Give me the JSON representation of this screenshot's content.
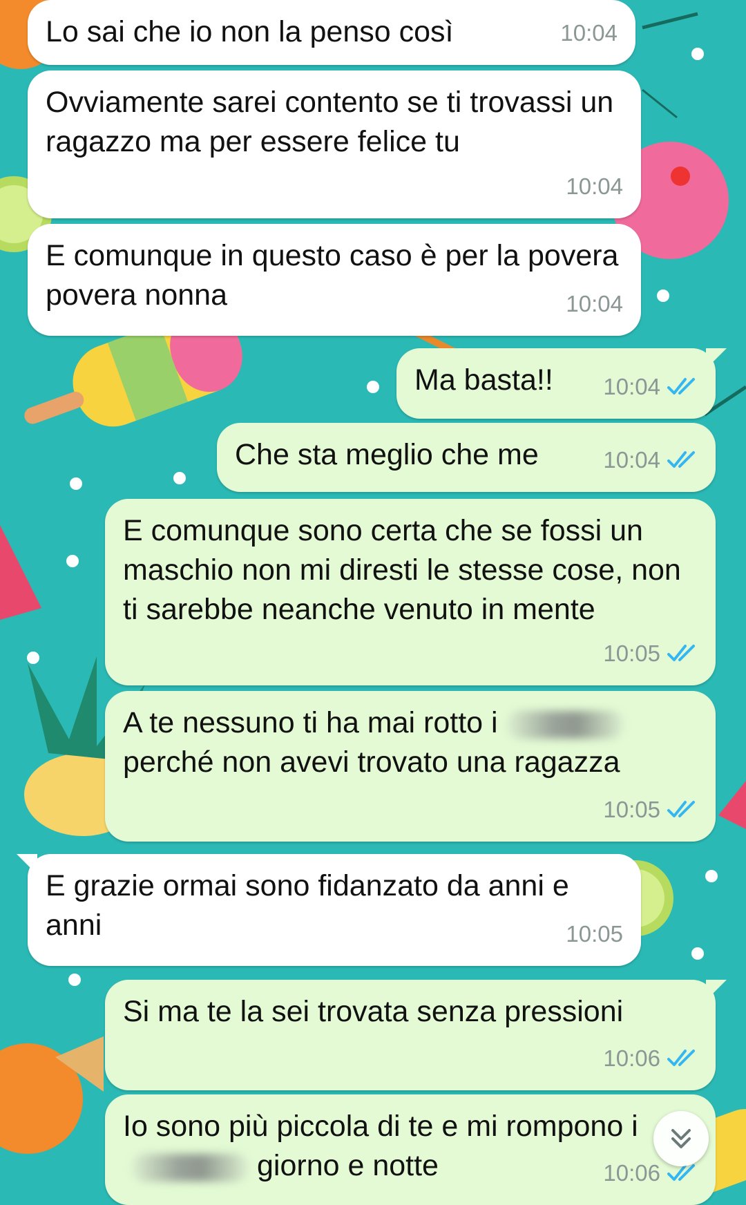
{
  "theme": {
    "wallpaper": "#2bb9b5",
    "incoming_bubble": "#ffffff",
    "outgoing_bubble": "#e3fad4",
    "read_tick": "#34b7f1"
  },
  "messages": [
    {
      "dir": "in",
      "text": "Lo sai che io non la penso così",
      "time": "10:04"
    },
    {
      "dir": "in",
      "text": "Ovviamente sarei contento se ti trovassi un ragazzo ma per essere felice tu",
      "time": "10:04"
    },
    {
      "dir": "in",
      "text": "E comunque in questo caso è per la povera povera nonna",
      "time": "10:04"
    },
    {
      "dir": "out",
      "text": "Ma basta!!",
      "time": "10:04",
      "status": "read"
    },
    {
      "dir": "out",
      "text": "Che sta meglio che me",
      "time": "10:04",
      "status": "read"
    },
    {
      "dir": "out",
      "text": "E comunque sono certa che se fossi un maschio non mi diresti le stesse cose, non ti sarebbe neanche venuto in mente",
      "time": "10:05",
      "status": "read"
    },
    {
      "dir": "out",
      "text_before": "A te nessuno ti ha mai rotto i",
      "text_after": "perché non avevi trovato una ragazza",
      "time": "10:05",
      "status": "read"
    },
    {
      "dir": "in",
      "text": "E grazie ormai sono fidanzato da anni e anni",
      "time": "10:05"
    },
    {
      "dir": "out",
      "text": "Si ma te la sei trovata senza pressioni",
      "time": "10:06",
      "status": "read"
    },
    {
      "dir": "out",
      "text_before": "Io sono più piccola di te e mi rompono i",
      "text_after": "giorno e notte",
      "time": "10:06",
      "status": "read"
    }
  ],
  "icons": {
    "read_receipt": "double-check-icon",
    "scroll_down": "chevron-double-down-icon"
  }
}
